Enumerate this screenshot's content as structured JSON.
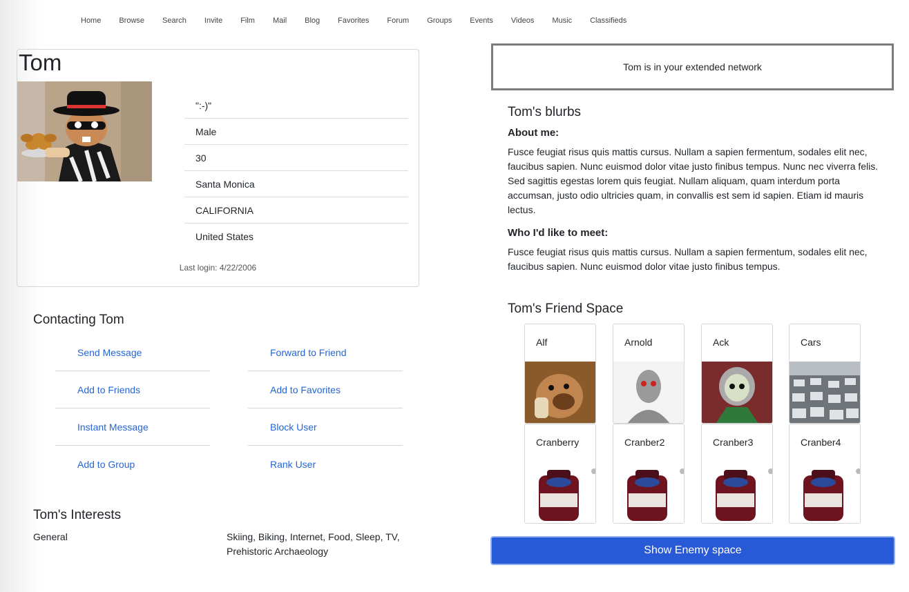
{
  "nav": [
    "Home",
    "Browse",
    "Search",
    "Invite",
    "Film",
    "Mail",
    "Blog",
    "Favorites",
    "Forum",
    "Groups",
    "Events",
    "Videos",
    "Music",
    "Classifieds"
  ],
  "profile": {
    "name": "Tom",
    "facts": [
      "\":-)\"",
      "Male",
      "30",
      "Santa Monica",
      "CALIFORNIA",
      "United States"
    ],
    "last_login": "Last login: 4/22/2006"
  },
  "contacting": {
    "title": "Contacting Tom",
    "left": [
      "Send Message",
      "Add to Friends",
      "Instant Message",
      "Add to Group"
    ],
    "right": [
      "Forward to Friend",
      "Add to Favorites",
      "Block User",
      "Rank User"
    ]
  },
  "interests": {
    "title": "Tom's Interests",
    "category": "General",
    "value": "Skiing, Biking, Internet, Food, Sleep, TV, Prehistoric Archaeology"
  },
  "network": {
    "text": "Tom is in your extended network"
  },
  "blurbs": {
    "title": "Tom's blurbs",
    "about_heading": "About me:",
    "about_text": "Fusce feugiat risus quis mattis cursus. Nullam a sapien fermentum, sodales elit nec, faucibus sapien. Nunc euismod dolor vitae justo finibus tempus. Nunc nec viverra felis. Sed sagittis egestas lorem quis feugiat. Nullam aliquam, quam interdum porta accumsan, justo odio ultricies quam, in convallis est sem id sapien. Etiam id mauris lectus.",
    "meet_heading": "Who I'd like to meet:",
    "meet_text": "Fusce feugiat risus quis mattis cursus. Nullam a sapien fermentum, sodales elit nec, faucibus sapien. Nunc euismod dolor vitae justo finibus tempus."
  },
  "friends": {
    "title": "Tom's Friend Space",
    "items": [
      "Alf",
      "Arnold",
      "Ack",
      "Cars",
      "Cranberry",
      "Cranber2",
      "Cranber3",
      "Cranber4"
    ]
  },
  "enemy_button": "Show Enemy space"
}
